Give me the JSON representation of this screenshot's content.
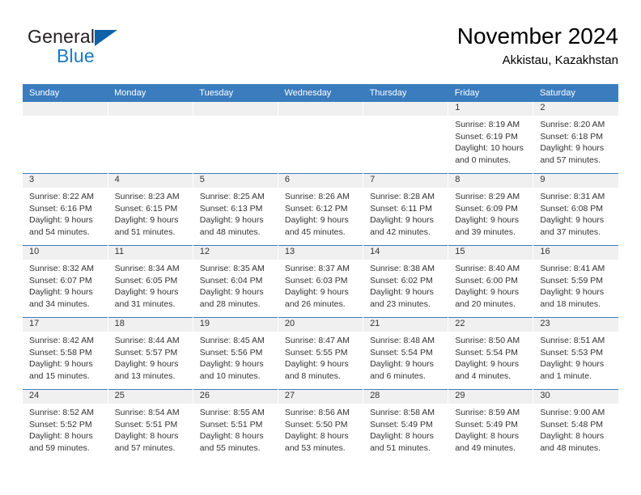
{
  "brand": {
    "name_part1": "General",
    "name_part2": "Blue",
    "logo_icon": "triangle-logo-icon",
    "accent_color": "#1061a8",
    "blue_text_color": "#1b79c3"
  },
  "header": {
    "month_title": "November 2024",
    "location": "Akkistau, Kazakhstan"
  },
  "calendar": {
    "header_bg_color": "#3a7cbe",
    "daynum_band_color": "#f0f0f0",
    "weekdays": [
      "Sunday",
      "Monday",
      "Tuesday",
      "Wednesday",
      "Thursday",
      "Friday",
      "Saturday"
    ],
    "weeks": [
      [
        {
          "empty": true
        },
        {
          "empty": true
        },
        {
          "empty": true
        },
        {
          "empty": true
        },
        {
          "empty": true
        },
        {
          "day": "1",
          "sunrise": "Sunrise: 8:19 AM",
          "sunset": "Sunset: 6:19 PM",
          "daylight": "Daylight: 10 hours and 0 minutes."
        },
        {
          "day": "2",
          "sunrise": "Sunrise: 8:20 AM",
          "sunset": "Sunset: 6:18 PM",
          "daylight": "Daylight: 9 hours and 57 minutes."
        }
      ],
      [
        {
          "day": "3",
          "sunrise": "Sunrise: 8:22 AM",
          "sunset": "Sunset: 6:16 PM",
          "daylight": "Daylight: 9 hours and 54 minutes."
        },
        {
          "day": "4",
          "sunrise": "Sunrise: 8:23 AM",
          "sunset": "Sunset: 6:15 PM",
          "daylight": "Daylight: 9 hours and 51 minutes."
        },
        {
          "day": "5",
          "sunrise": "Sunrise: 8:25 AM",
          "sunset": "Sunset: 6:13 PM",
          "daylight": "Daylight: 9 hours and 48 minutes."
        },
        {
          "day": "6",
          "sunrise": "Sunrise: 8:26 AM",
          "sunset": "Sunset: 6:12 PM",
          "daylight": "Daylight: 9 hours and 45 minutes."
        },
        {
          "day": "7",
          "sunrise": "Sunrise: 8:28 AM",
          "sunset": "Sunset: 6:11 PM",
          "daylight": "Daylight: 9 hours and 42 minutes."
        },
        {
          "day": "8",
          "sunrise": "Sunrise: 8:29 AM",
          "sunset": "Sunset: 6:09 PM",
          "daylight": "Daylight: 9 hours and 39 minutes."
        },
        {
          "day": "9",
          "sunrise": "Sunrise: 8:31 AM",
          "sunset": "Sunset: 6:08 PM",
          "daylight": "Daylight: 9 hours and 37 minutes."
        }
      ],
      [
        {
          "day": "10",
          "sunrise": "Sunrise: 8:32 AM",
          "sunset": "Sunset: 6:07 PM",
          "daylight": "Daylight: 9 hours and 34 minutes."
        },
        {
          "day": "11",
          "sunrise": "Sunrise: 8:34 AM",
          "sunset": "Sunset: 6:05 PM",
          "daylight": "Daylight: 9 hours and 31 minutes."
        },
        {
          "day": "12",
          "sunrise": "Sunrise: 8:35 AM",
          "sunset": "Sunset: 6:04 PM",
          "daylight": "Daylight: 9 hours and 28 minutes."
        },
        {
          "day": "13",
          "sunrise": "Sunrise: 8:37 AM",
          "sunset": "Sunset: 6:03 PM",
          "daylight": "Daylight: 9 hours and 26 minutes."
        },
        {
          "day": "14",
          "sunrise": "Sunrise: 8:38 AM",
          "sunset": "Sunset: 6:02 PM",
          "daylight": "Daylight: 9 hours and 23 minutes."
        },
        {
          "day": "15",
          "sunrise": "Sunrise: 8:40 AM",
          "sunset": "Sunset: 6:00 PM",
          "daylight": "Daylight: 9 hours and 20 minutes."
        },
        {
          "day": "16",
          "sunrise": "Sunrise: 8:41 AM",
          "sunset": "Sunset: 5:59 PM",
          "daylight": "Daylight: 9 hours and 18 minutes."
        }
      ],
      [
        {
          "day": "17",
          "sunrise": "Sunrise: 8:42 AM",
          "sunset": "Sunset: 5:58 PM",
          "daylight": "Daylight: 9 hours and 15 minutes."
        },
        {
          "day": "18",
          "sunrise": "Sunrise: 8:44 AM",
          "sunset": "Sunset: 5:57 PM",
          "daylight": "Daylight: 9 hours and 13 minutes."
        },
        {
          "day": "19",
          "sunrise": "Sunrise: 8:45 AM",
          "sunset": "Sunset: 5:56 PM",
          "daylight": "Daylight: 9 hours and 10 minutes."
        },
        {
          "day": "20",
          "sunrise": "Sunrise: 8:47 AM",
          "sunset": "Sunset: 5:55 PM",
          "daylight": "Daylight: 9 hours and 8 minutes."
        },
        {
          "day": "21",
          "sunrise": "Sunrise: 8:48 AM",
          "sunset": "Sunset: 5:54 PM",
          "daylight": "Daylight: 9 hours and 6 minutes."
        },
        {
          "day": "22",
          "sunrise": "Sunrise: 8:50 AM",
          "sunset": "Sunset: 5:54 PM",
          "daylight": "Daylight: 9 hours and 4 minutes."
        },
        {
          "day": "23",
          "sunrise": "Sunrise: 8:51 AM",
          "sunset": "Sunset: 5:53 PM",
          "daylight": "Daylight: 9 hours and 1 minute."
        }
      ],
      [
        {
          "day": "24",
          "sunrise": "Sunrise: 8:52 AM",
          "sunset": "Sunset: 5:52 PM",
          "daylight": "Daylight: 8 hours and 59 minutes."
        },
        {
          "day": "25",
          "sunrise": "Sunrise: 8:54 AM",
          "sunset": "Sunset: 5:51 PM",
          "daylight": "Daylight: 8 hours and 57 minutes."
        },
        {
          "day": "26",
          "sunrise": "Sunrise: 8:55 AM",
          "sunset": "Sunset: 5:51 PM",
          "daylight": "Daylight: 8 hours and 55 minutes."
        },
        {
          "day": "27",
          "sunrise": "Sunrise: 8:56 AM",
          "sunset": "Sunset: 5:50 PM",
          "daylight": "Daylight: 8 hours and 53 minutes."
        },
        {
          "day": "28",
          "sunrise": "Sunrise: 8:58 AM",
          "sunset": "Sunset: 5:49 PM",
          "daylight": "Daylight: 8 hours and 51 minutes."
        },
        {
          "day": "29",
          "sunrise": "Sunrise: 8:59 AM",
          "sunset": "Sunset: 5:49 PM",
          "daylight": "Daylight: 8 hours and 49 minutes."
        },
        {
          "day": "30",
          "sunrise": "Sunrise: 9:00 AM",
          "sunset": "Sunset: 5:48 PM",
          "daylight": "Daylight: 8 hours and 48 minutes."
        }
      ]
    ]
  }
}
